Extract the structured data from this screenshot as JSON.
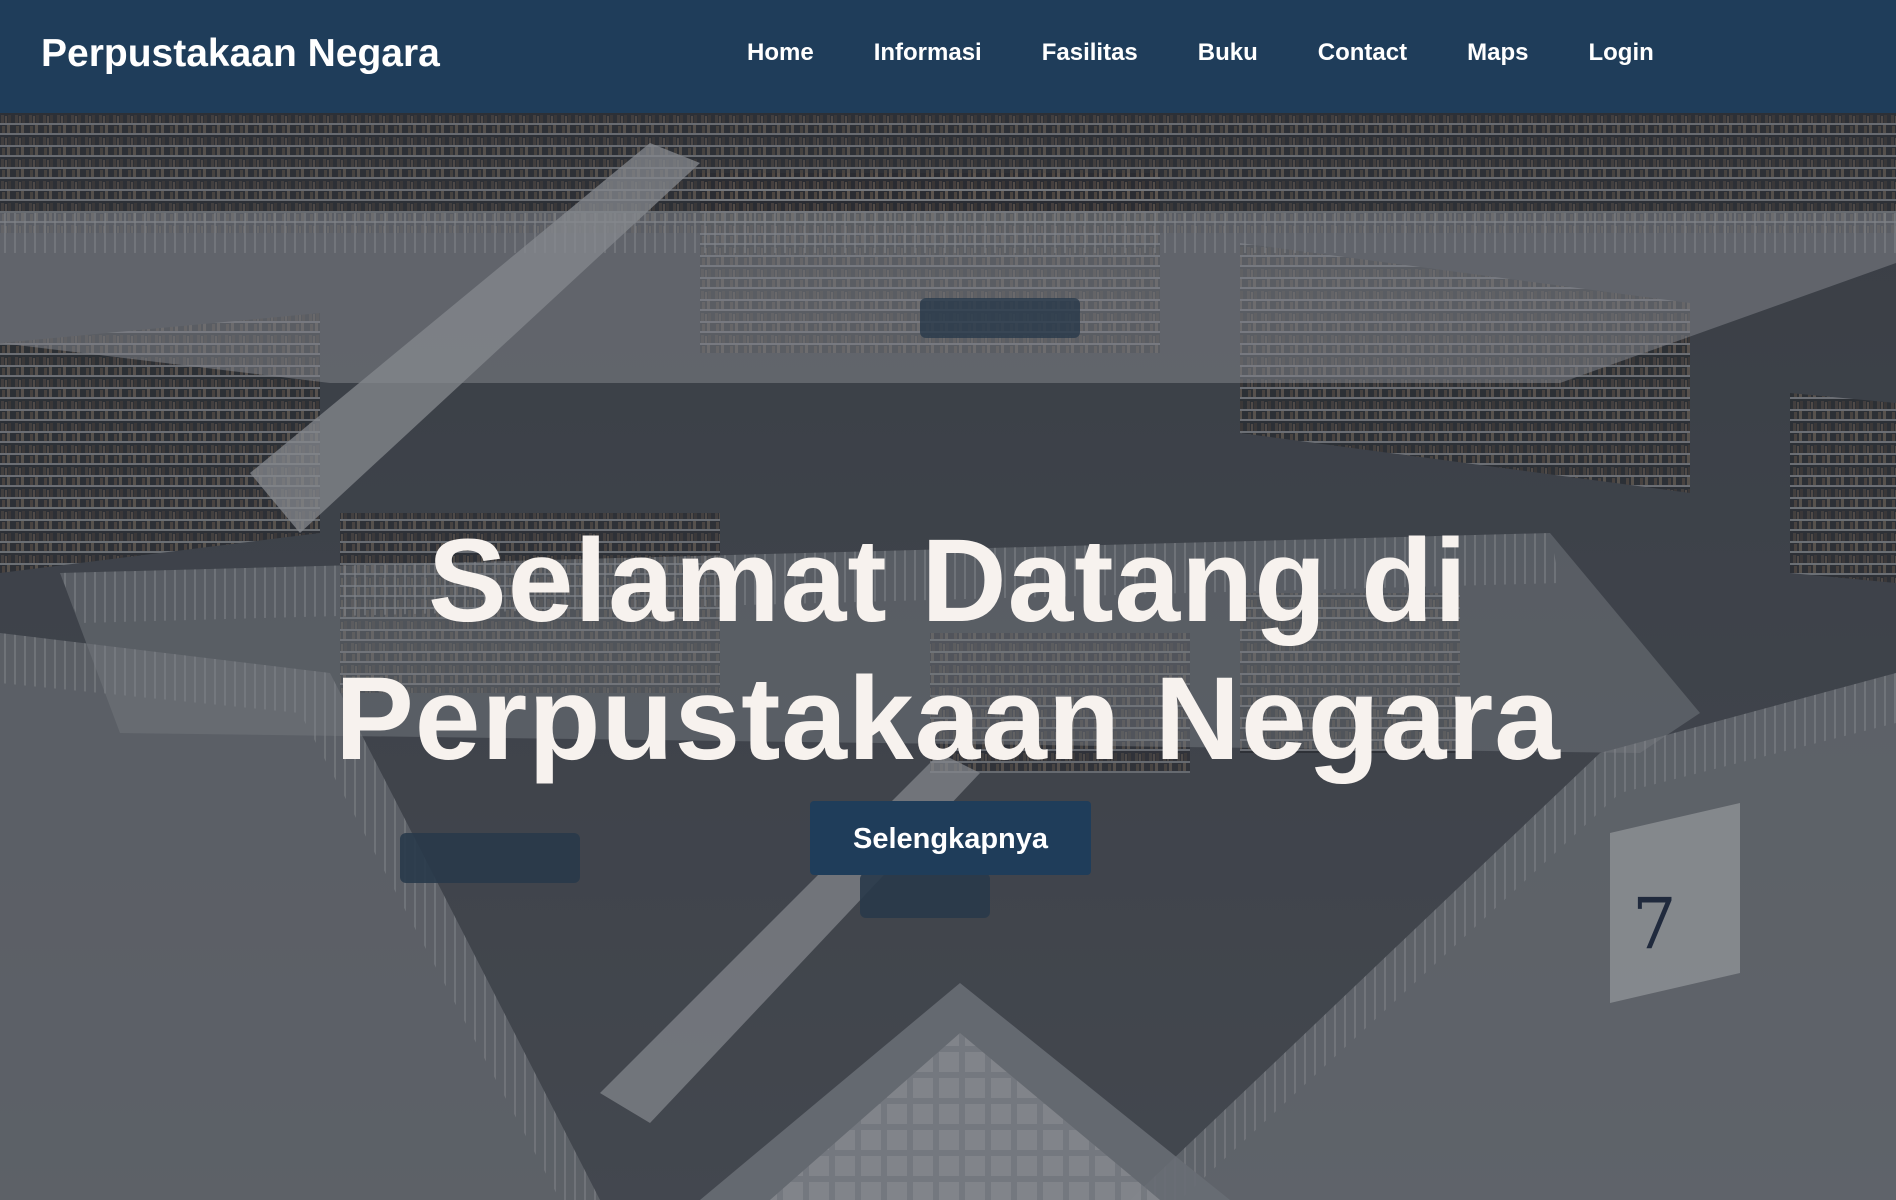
{
  "navbar": {
    "brand": "Perpustakaan Negara",
    "links": [
      {
        "label": "Home"
      },
      {
        "label": "Informasi"
      },
      {
        "label": "Fasilitas"
      },
      {
        "label": "Buku"
      },
      {
        "label": "Contact"
      },
      {
        "label": "Maps"
      },
      {
        "label": "Login"
      }
    ]
  },
  "hero": {
    "title_line1": "Selamat Datang di",
    "title_line2": "Perpustakaan Negara",
    "cta_label": "Selengkapnya",
    "background_image": "library-atrium-photo"
  },
  "colors": {
    "navbar": "#1f3d5a",
    "button": "#1f3d5a",
    "hero_text": "#f7f2ee"
  }
}
